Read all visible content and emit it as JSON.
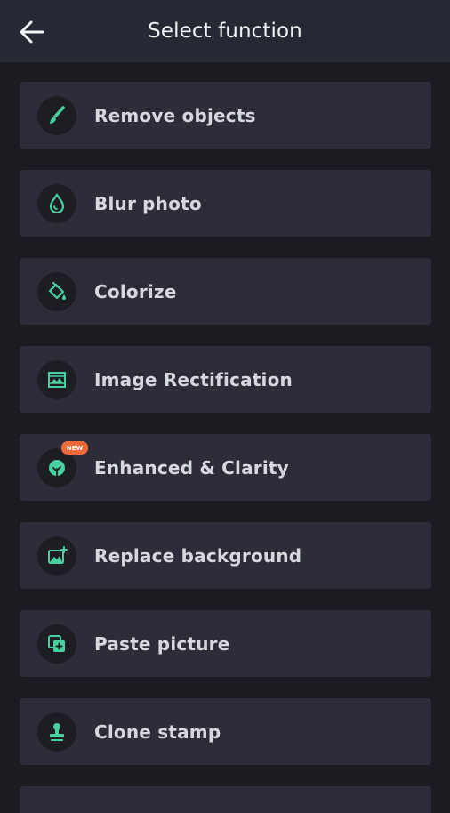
{
  "header": {
    "title": "Select function"
  },
  "colors": {
    "accent": "#4ad0a0",
    "badge": "#ee6a3a",
    "card": "#2c2d38",
    "background": "#1b1c21"
  },
  "items": [
    {
      "label": "Remove objects",
      "icon": "brush-icon"
    },
    {
      "label": "Blur photo",
      "icon": "drop-icon"
    },
    {
      "label": "Colorize",
      "icon": "paint-bucket-icon"
    },
    {
      "label": "Image Rectification",
      "icon": "image-frame-icon"
    },
    {
      "label": "Enhanced & Clarity",
      "icon": "enhance-icon",
      "badge": "NEW"
    },
    {
      "label": "Replace background",
      "icon": "image-plus-icon"
    },
    {
      "label": "Paste picture",
      "icon": "paste-picture-icon"
    },
    {
      "label": "Clone stamp",
      "icon": "stamp-icon"
    }
  ]
}
